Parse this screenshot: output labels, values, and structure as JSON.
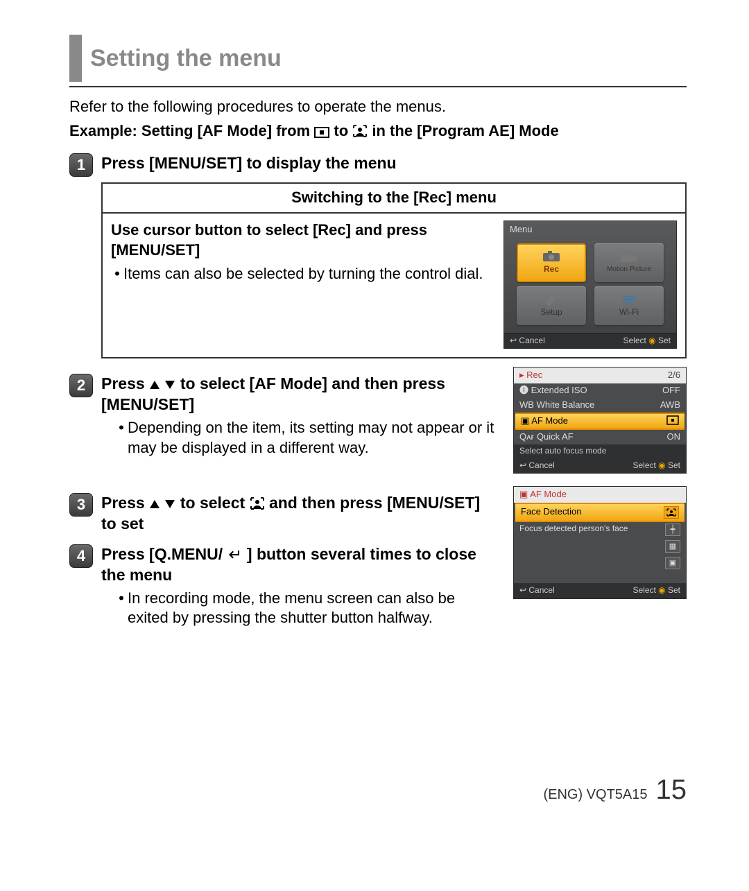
{
  "title": "Setting the menu",
  "intro": "Refer to the following procedures to operate the menus.",
  "example_pre": "Example: Setting [AF Mode] from ",
  "example_mid": " to ",
  "example_post": " in the [Program AE] Mode",
  "step1": {
    "num": "1",
    "title": "Press [MENU/SET] to display the menu",
    "box_header": "Switching to the [Rec] menu",
    "box_sub": "Use cursor button to select [Rec] and press [MENU/SET]",
    "bullet": "Items can also be selected by turning the control dial.",
    "cam": {
      "header": "Menu",
      "tiles": {
        "rec": "Rec",
        "motion": "Motion Picture",
        "setup": "Setup",
        "wifi": "Wi-Fi"
      },
      "cancel": "Cancel",
      "select": "Select",
      "set": "Set"
    }
  },
  "step2": {
    "num": "2",
    "title_pre": "Press ",
    "title_mid": " to select [AF Mode] and then press [MENU/SET]",
    "bullet": "Depending on the item, its setting may not appear or it may be displayed in a different way.",
    "cam": {
      "top_label": "Rec",
      "page": "2/6",
      "rows": {
        "r1": {
          "name": "Extended ISO",
          "val": "OFF"
        },
        "r2": {
          "name": "White Balance",
          "val": "AWB"
        },
        "r3": {
          "name": "AF Mode",
          "val": ""
        },
        "r4": {
          "name": "Quick AF",
          "val": "ON"
        }
      },
      "info": "Select auto focus mode",
      "cancel": "Cancel",
      "select": "Select",
      "set": "Set"
    }
  },
  "step3": {
    "num": "3",
    "title_pre": "Press ",
    "title_mid": " to select ",
    "title_post": " and then press [MENU/SET] to set",
    "cam": {
      "top": "AF Mode",
      "row_sel": "Face Detection",
      "desc": "Focus detected person's face",
      "cancel": "Cancel",
      "select": "Select",
      "set": "Set"
    }
  },
  "step4": {
    "num": "4",
    "title_pre": "Press [Q.MENU/",
    "title_post": "] button several times to close the menu",
    "bullet": "In recording mode, the menu screen can also be exited by pressing the shutter button halfway."
  },
  "footer": {
    "code": "(ENG) VQT5A15",
    "page": "15"
  }
}
